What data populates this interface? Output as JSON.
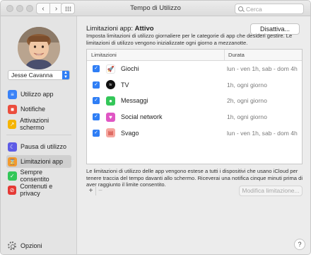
{
  "window": {
    "title": "Tempo di Utilizzo"
  },
  "toolbar": {
    "back_glyph": "‹",
    "forward_glyph": "›",
    "search_placeholder": "Cerca"
  },
  "sidebar": {
    "user_name": "Jesse Cavanna",
    "items": [
      {
        "label": "Utilizzo app",
        "icon": "layers-icon",
        "color": "#3a82f7"
      },
      {
        "label": "Notifiche",
        "icon": "bell-icon",
        "color": "#eb4d3d"
      },
      {
        "label": "Attivazioni schermo",
        "icon": "pickups-icon",
        "color": "#f5b400"
      },
      {
        "label": "Pausa di utilizzo",
        "icon": "moon-icon",
        "color": "#5e5ce6"
      },
      {
        "label": "Limitazioni app",
        "icon": "hourglass-icon",
        "color": "#f29a2e"
      },
      {
        "label": "Sempre consentito",
        "icon": "checkmark-icon",
        "color": "#34c759"
      },
      {
        "label": "Contenuti e privacy",
        "icon": "restriction-icon",
        "color": "#e53935"
      }
    ],
    "options_label": "Opzioni"
  },
  "main": {
    "status_prefix": "Limitazioni app:",
    "status_value": "Attivo",
    "disable_button": "Disattiva...",
    "description": "Imposta limitazioni di utilizzo giornaliere per le categorie di app che desideri gestire. Le limitazioni di utilizzo vengono inizializzate ogni giorno a mezzanotte.",
    "table": {
      "col_app": "Limitazioni",
      "col_duration": "Durata",
      "rows": [
        {
          "checked": true,
          "name": "Giochi",
          "duration": "lun - ven 1h, sab - dom 4h",
          "icon": "rocket-icon",
          "color": "#ffffff"
        },
        {
          "checked": true,
          "name": "TV",
          "duration": "1h, ogni giorno",
          "icon": "apple-tv-icon",
          "color": "#111111"
        },
        {
          "checked": true,
          "name": "Messaggi",
          "duration": "2h, ogni giorno",
          "icon": "messages-icon",
          "color": "#34c759"
        },
        {
          "checked": true,
          "name": "Social network",
          "duration": "1h, ogni giorno",
          "icon": "social-icon",
          "color": "#e056c4"
        },
        {
          "checked": true,
          "name": "Svago",
          "duration": "lun - ven 1h, sab - dom 4h",
          "icon": "popcorn-icon",
          "color": "#f6a7a0"
        }
      ]
    },
    "note": "Le limitazioni di utilizzo delle app vengono estese a tutti i dispositivi che usano iCloud per tenere traccia del tempo davanti allo schermo. Riceverai una notifica cinque minuti prima di aver raggiunto il limite consentito.",
    "add_glyph": "+",
    "remove_glyph": "−",
    "modify_button": "Modifica limitazione...",
    "help_glyph": "?"
  }
}
